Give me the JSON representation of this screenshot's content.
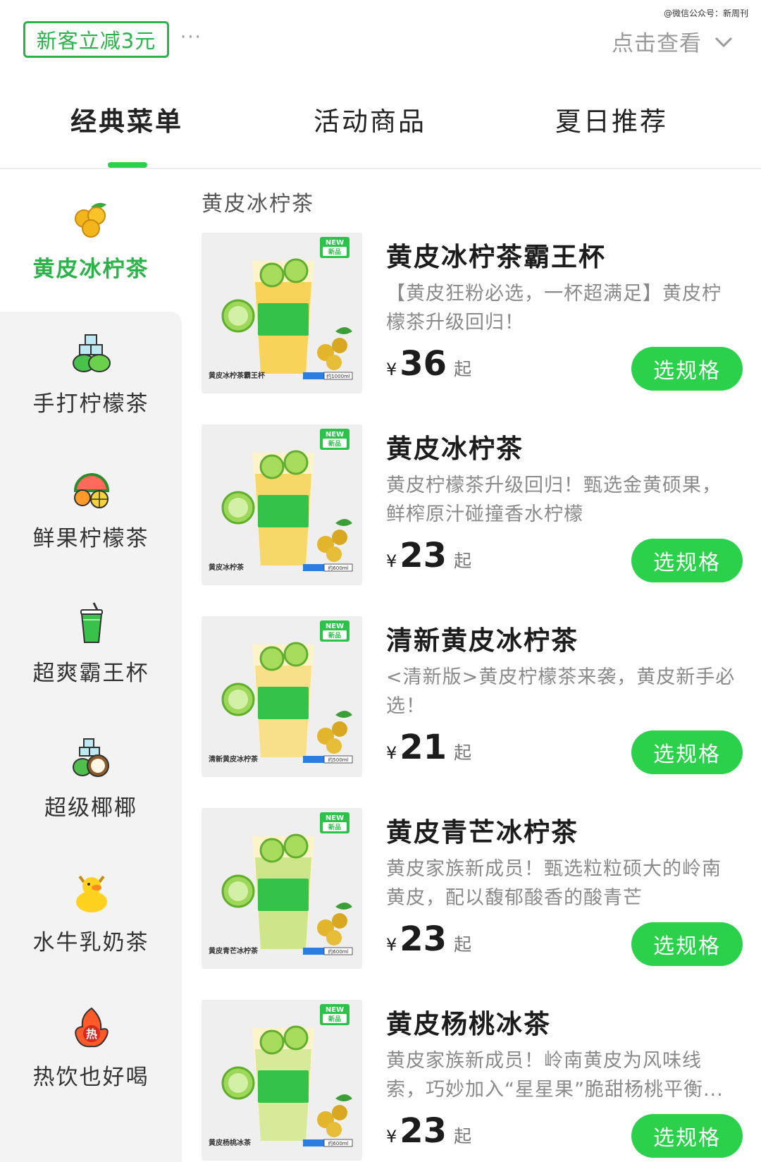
{
  "promo": {
    "badge_label": "新客立减3元",
    "more_label": "···",
    "view_label": "点击查看",
    "watermark": "@微信公众号：新周刊"
  },
  "tabs": [
    {
      "label": "经典菜单",
      "active": true
    },
    {
      "label": "活动商品",
      "active": false
    },
    {
      "label": "夏日推荐",
      "active": false
    }
  ],
  "sidebar": {
    "items": [
      {
        "label": "黄皮冰柠茶",
        "icon": "yellow-fruit-icon",
        "active": true
      },
      {
        "label": "手打柠檬茶",
        "icon": "lemon-ice-icon",
        "active": false
      },
      {
        "label": "鲜果柠檬茶",
        "icon": "fruit-mix-icon",
        "active": false
      },
      {
        "label": "超爽霸王杯",
        "icon": "cup-icon",
        "active": false
      },
      {
        "label": "超级椰椰",
        "icon": "coconut-icon",
        "active": false
      },
      {
        "label": "水牛乳奶茶",
        "icon": "duck-icon",
        "active": false
      },
      {
        "label": "热饮也好喝",
        "icon": "hot-drink-icon",
        "active": false
      }
    ]
  },
  "section": {
    "title": "黄皮冰柠茶"
  },
  "products": [
    {
      "name": "黄皮冰柠茶霸王杯",
      "desc": "【黄皮狂粉必选，一杯超满足】黄皮柠檬茶升级回归！",
      "currency": "¥",
      "price": "36",
      "suffix": "起",
      "button": "选规格",
      "thumb": {
        "new": "NEW",
        "tag": "新品",
        "caption": "黄皮冰柠茶霸王杯",
        "volume": "约1000ml",
        "liquid": "#f7d35a"
      }
    },
    {
      "name": "黄皮冰柠茶",
      "desc": "黄皮柠檬茶升级回归！甄选金黄硕果，鲜榨原汁碰撞香水柠檬",
      "currency": "¥",
      "price": "23",
      "suffix": "起",
      "button": "选规格",
      "thumb": {
        "new": "NEW",
        "tag": "新品",
        "caption": "黄皮冰柠茶",
        "volume": "约600ml",
        "liquid": "#f5d867"
      }
    },
    {
      "name": "清新黄皮冰柠茶",
      "desc": "<清新版>黄皮柠檬茶来袭，黄皮新手必选！",
      "currency": "¥",
      "price": "21",
      "suffix": "起",
      "button": "选规格",
      "thumb": {
        "new": "NEW",
        "tag": "新品",
        "caption": "清新黄皮冰柠茶",
        "volume": "约500ml",
        "liquid": "#f8df8a"
      }
    },
    {
      "name": "黄皮青芒冰柠茶",
      "desc": "黄皮家族新成员！甄选粒粒硕大的岭南黄皮，配以馥郁酸香的酸青芒",
      "currency": "¥",
      "price": "23",
      "suffix": "起",
      "button": "选规格",
      "thumb": {
        "new": "NEW",
        "tag": "新品",
        "caption": "黄皮青芒冰柠茶",
        "volume": "约600ml",
        "liquid": "#cfe58a"
      }
    },
    {
      "name": "黄皮杨桃冰茶",
      "desc": "黄皮家族新成员！岭南黄皮为风味线索，巧妙加入“星星果”脆甜杨桃平衡...",
      "currency": "¥",
      "price": "23",
      "suffix": "起",
      "button": "选规格",
      "thumb": {
        "new": "NEW",
        "tag": "新品",
        "caption": "黄皮杨桃冰茶",
        "volume": "约600ml",
        "liquid": "#d7ea9a"
      }
    }
  ],
  "colors": {
    "accent": "#2bd14a",
    "accent_text": "#2bb34a",
    "sidebar_bg": "#f3f3f3"
  }
}
